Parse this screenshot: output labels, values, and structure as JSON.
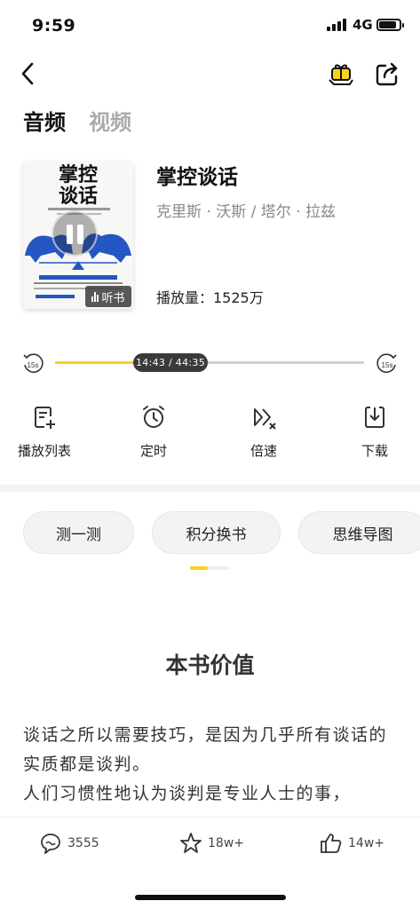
{
  "status_bar": {
    "time": "9:59",
    "network": "4G"
  },
  "tabs": [
    {
      "label": "音频",
      "active": true
    },
    {
      "label": "视频",
      "active": false
    }
  ],
  "book": {
    "cover_title_line1": "掌控",
    "cover_title_line2": "谈话",
    "title": "掌控谈话",
    "author": "克里斯 · 沃斯 / 塔尔 · 拉兹",
    "play_count": "播放量：1525万",
    "listen_badge": "听书"
  },
  "player": {
    "time_display": "14:43 / 44:35",
    "progress": 0.33,
    "rewind_label": "15s",
    "forward_label": "15s"
  },
  "actions": [
    {
      "label": "播放列表",
      "icon": "playlist-icon"
    },
    {
      "label": "定时",
      "icon": "timer-icon"
    },
    {
      "label": "倍速",
      "icon": "speed-icon"
    },
    {
      "label": "下载",
      "icon": "download-icon"
    }
  ],
  "chips": [
    {
      "label": "测一测"
    },
    {
      "label": "积分换书"
    },
    {
      "label": "思维导图"
    }
  ],
  "content": {
    "section_title": "本书价值",
    "paragraph_1": "谈话之所以需要技巧，是因为几乎所有谈话的实质都是谈判。",
    "paragraph_2": "人们习惯性地认为谈判是专业人士的事，"
  },
  "bottom_bar": {
    "comments": "3555",
    "favorites": "18w+",
    "likes": "14w+"
  },
  "colors": {
    "accent": "#f7d11e",
    "cover_blue": "#2456c4"
  }
}
